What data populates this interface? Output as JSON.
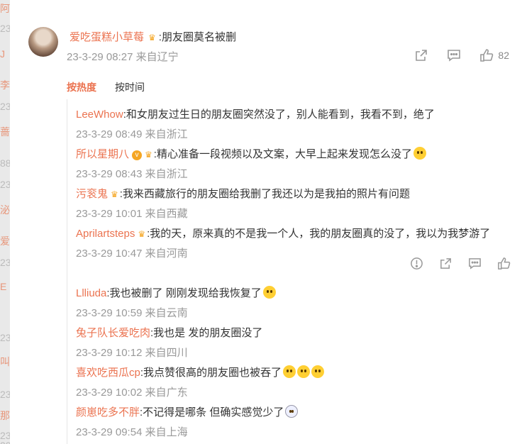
{
  "background_strip": [
    "阿",
    "23",
    "J",
    "李",
    "23",
    "蔷",
    "88",
    "23",
    "泌",
    "爱",
    "23",
    "E",
    "23",
    "叫",
    "23",
    "那",
    "23",
    "23"
  ],
  "post": {
    "author": "爱吃蛋糕小草莓",
    "text": ":朋友圈莫名被删",
    "time": "23-3-29 08:27 来自辽宁",
    "likes": "82"
  },
  "sort": {
    "hot": "按热度",
    "time": "按时间"
  },
  "replies": [
    {
      "name": "LeeWhow",
      "text": ":和女朋友过生日的朋友圈突然没了，别人能看到，我看不到，绝了",
      "meta": "23-3-29 08:49 来自浙江",
      "badge": false,
      "crown": false,
      "emoji": []
    },
    {
      "name": "所以星期八",
      "text": ":精心准备一段视频以及文案，大早上起来发现怎么没了",
      "meta": "23-3-29 08:43 来自浙江",
      "badge": true,
      "crown": true,
      "emoji": [
        "cry"
      ]
    },
    {
      "name": "污衮鬼",
      "text": ":我来西藏旅行的朋友圈给我删了我还以为是我拍的照片有问题",
      "meta": "23-3-29 10:01 来自西藏",
      "badge": false,
      "crown": true,
      "emoji": []
    },
    {
      "name": "Aprilartsteps",
      "text": ":我的天，原来真的不是我一个人，我的朋友圈真的没了，我以为我梦游了",
      "meta": "23-3-29 10:47 来自河南",
      "badge": false,
      "crown": true,
      "emoji": [],
      "actions": true
    },
    {
      "name": "Llliuda",
      "text": ":我也被删了 刚刚发现给我恢复了",
      "meta": "23-3-29 10:59 来自云南",
      "badge": false,
      "crown": false,
      "emoji": [
        "shock"
      ]
    },
    {
      "name": "兔子队长爱吃肉",
      "text": ":我也是 发的朋友圈没了",
      "meta": "23-3-29 10:12 来自四川",
      "badge": false,
      "crown": false,
      "emoji": []
    },
    {
      "name": "喜欢吃西瓜cp",
      "text": ":我点赞很高的朋友圈也被吞了",
      "meta": "23-3-29 10:02 来自广东",
      "badge": false,
      "crown": false,
      "emoji": [
        "cry",
        "cry",
        "cry"
      ]
    },
    {
      "name": "颜崽吃多不胖",
      "text": ":不记得是哪条 但确实感觉少了",
      "meta": "23-3-29 09:54 来自上海",
      "badge": false,
      "crown": false,
      "emoji": [
        "ghost"
      ]
    }
  ]
}
